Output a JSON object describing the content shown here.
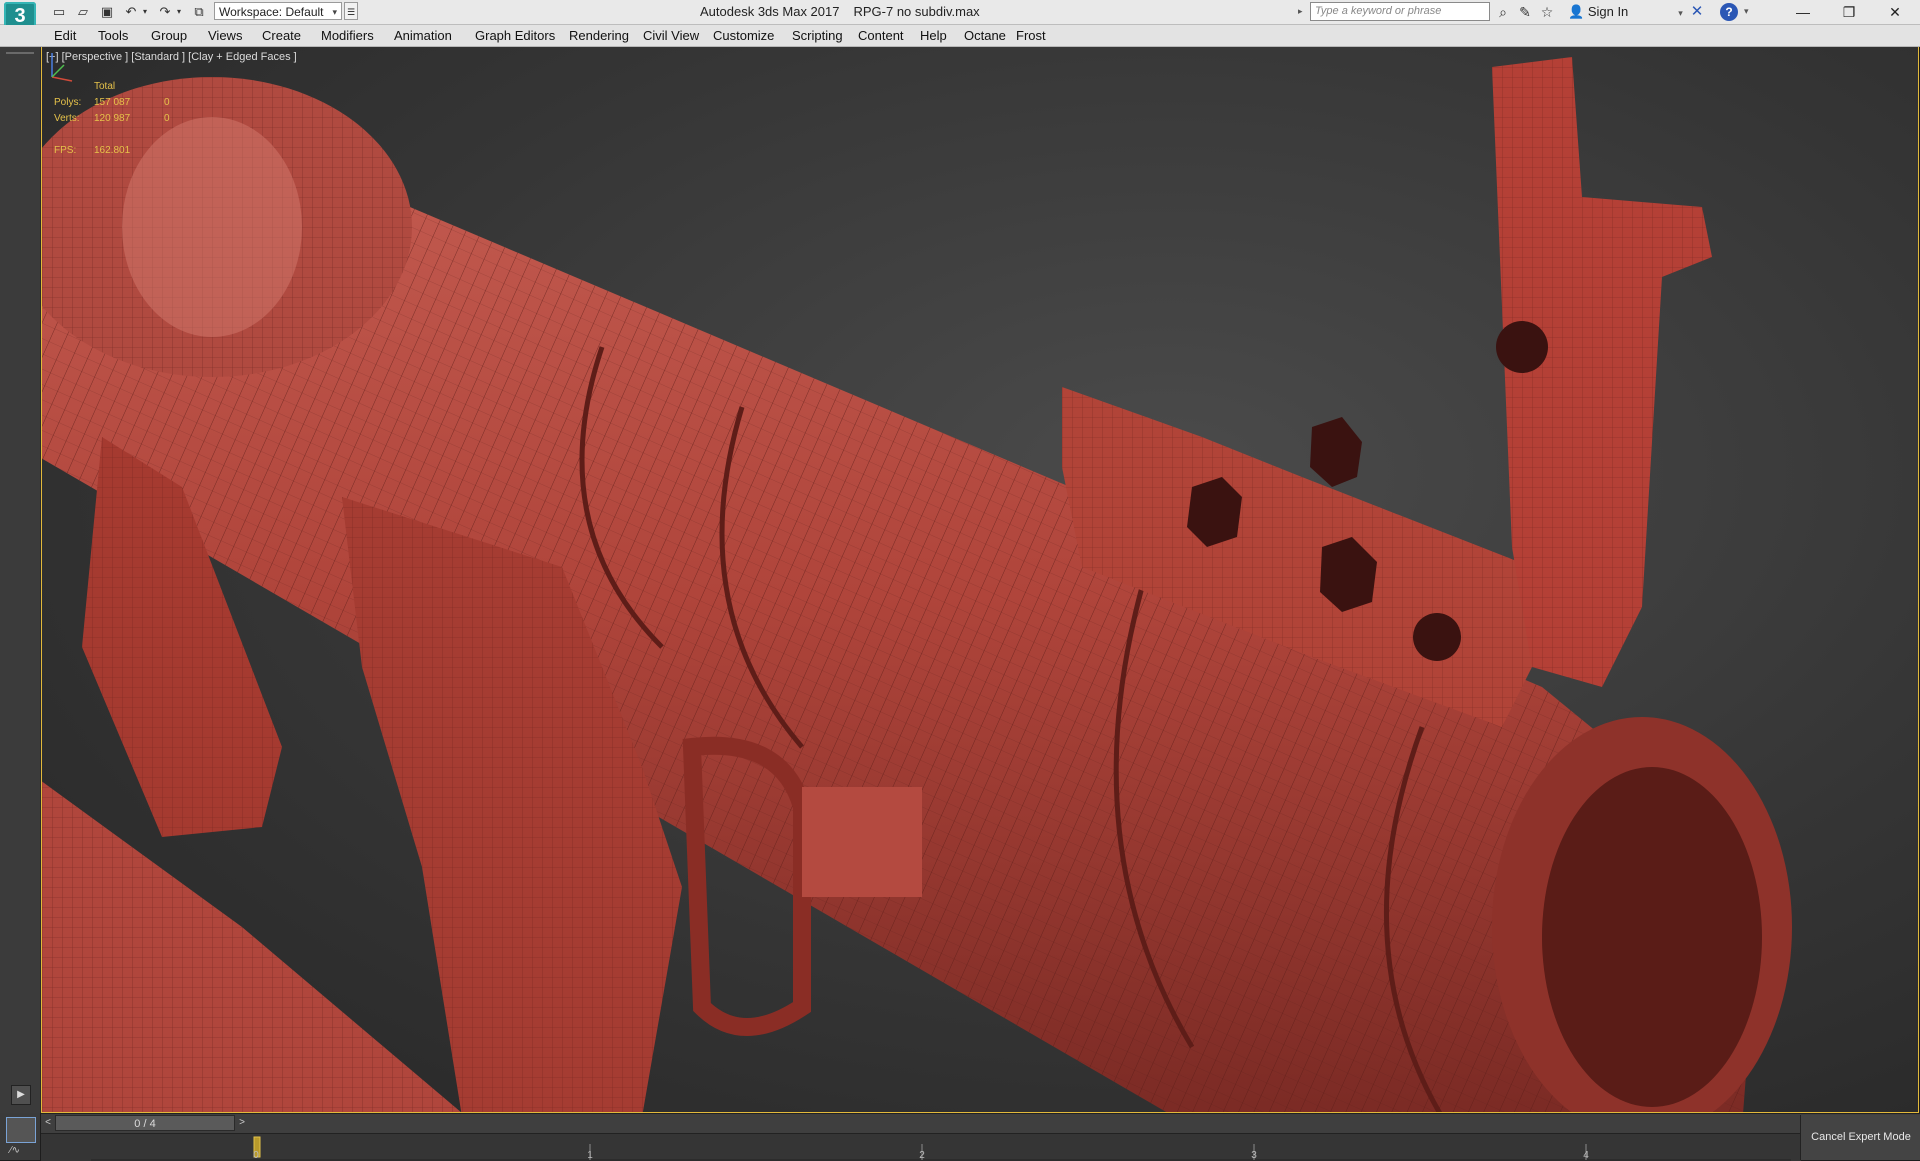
{
  "titlebar": {
    "app_logo": "3",
    "workspace_label": "Workspace: Default",
    "app_title": "Autodesk 3ds Max 2017",
    "file_name": "RPG-7 no subdiv.max",
    "search_placeholder": "Type a keyword or phrase",
    "sign_in": "Sign In",
    "help_label": "?",
    "accent_color": "#2b57b5"
  },
  "menu": {
    "items": [
      "Edit",
      "Tools",
      "Group",
      "Views",
      "Create",
      "Modifiers",
      "Animation",
      "Graph Editors",
      "Rendering",
      "Civil View",
      "Customize",
      "Scripting",
      "Content",
      "Help",
      "Octane",
      "Frost"
    ]
  },
  "viewport": {
    "label": "[+] [Perspective ] [Standard ] [Clay + Edged Faces ]",
    "stats": {
      "header": "Total",
      "polys_label": "Polys:",
      "polys_value": "157 087",
      "polys_sel": "0",
      "verts_label": "Verts:",
      "verts_value": "120 987",
      "verts_sel": "0",
      "fps_label": "FPS:",
      "fps_value": "162.801"
    },
    "model_color": "#b8473d",
    "stats_color": "#e6c24a",
    "border_color": "#e2b93b"
  },
  "timeline": {
    "frame_display": "0 / 4",
    "prev": "<",
    "next": ">",
    "ticks": [
      "0",
      "1",
      "2",
      "3",
      "4"
    ]
  },
  "status": {
    "cancel_expert": "Cancel Expert Mode"
  }
}
